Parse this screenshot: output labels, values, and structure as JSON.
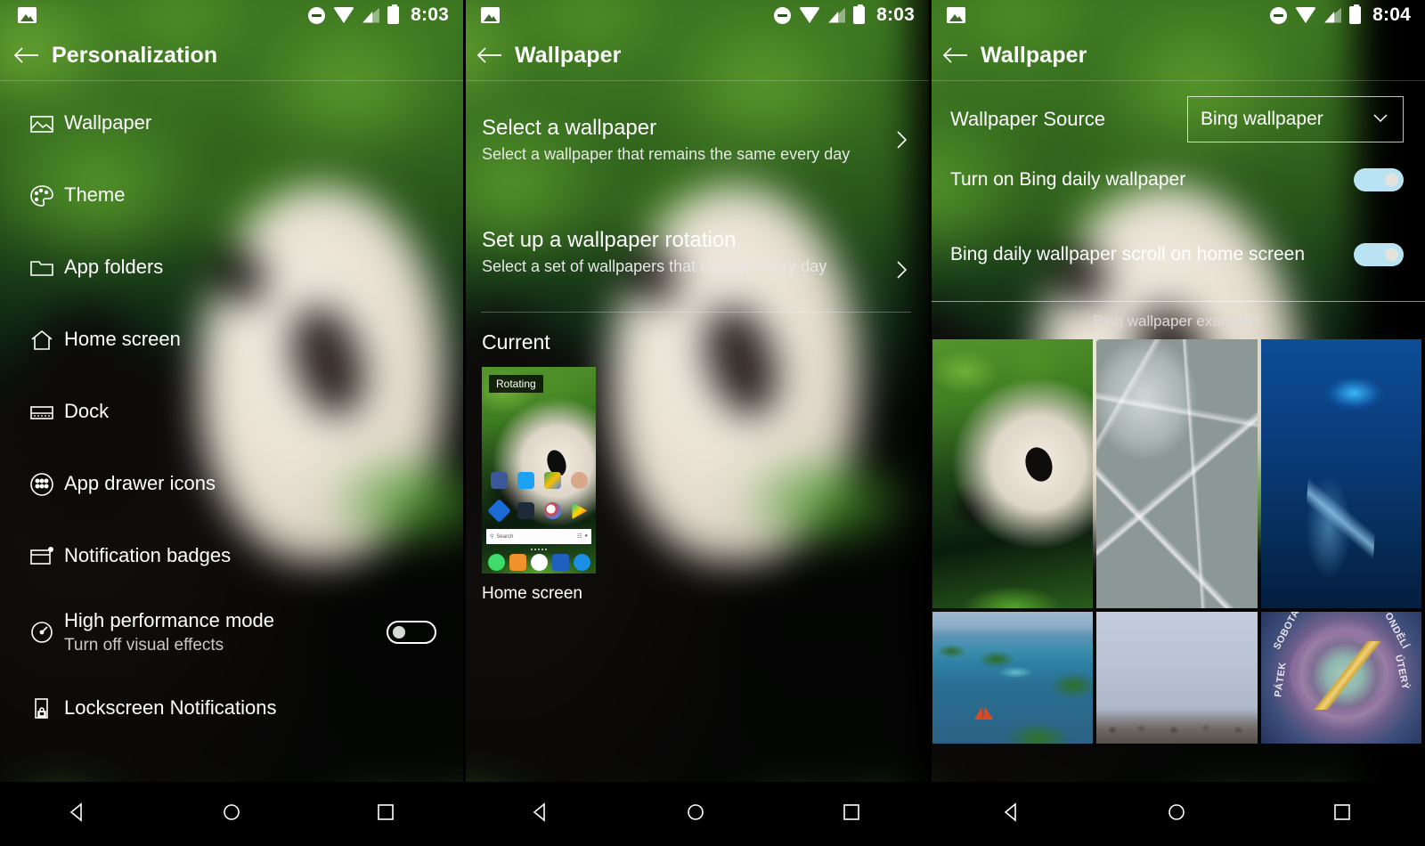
{
  "status_bar": {
    "notification_icon": "photo-icon",
    "icons": [
      "do-not-disturb-icon",
      "wifi-icon",
      "signal-icon",
      "battery-icon"
    ],
    "time_panel1": "8:03",
    "time_panel2": "8:03",
    "time_panel3": "8:04"
  },
  "panel1": {
    "title": "Personalization",
    "back_icon": "back-arrow-icon",
    "items": [
      {
        "label": "Wallpaper",
        "icon": "image-icon"
      },
      {
        "label": "Theme",
        "icon": "palette-icon"
      },
      {
        "label": "App folders",
        "icon": "folder-icon"
      },
      {
        "label": "Home screen",
        "icon": "home-icon"
      },
      {
        "label": "Dock",
        "icon": "dock-icon"
      },
      {
        "label": "App drawer icons",
        "icon": "app-drawer-icon"
      },
      {
        "label": "Notification badges",
        "icon": "notification-badge-icon"
      },
      {
        "label": "High performance mode",
        "sub": "Turn off visual effects",
        "icon": "speedometer-icon",
        "toggle": "off"
      },
      {
        "label": "Lockscreen Notifications",
        "icon": "lock-phone-icon"
      }
    ]
  },
  "panel2": {
    "title": "Wallpaper",
    "back_icon": "back-arrow-icon",
    "rows": [
      {
        "title": "Select a wallpaper",
        "sub": "Select a wallpaper that remains the same every day",
        "chevron": "chevron-right-icon"
      },
      {
        "title": "Set up a wallpaper rotation",
        "sub": "Select a set of wallpapers that change every day",
        "chevron": "chevron-right-icon"
      }
    ],
    "section_label": "Current",
    "thumbnail": {
      "badge": "Rotating",
      "caption": "Home screen",
      "search_placeholder": "Search",
      "row1_icons": [
        "facebook-icon",
        "twitter-icon",
        "maps-icon",
        "contact-icon"
      ],
      "row2_icons": [
        "outlook-icon",
        "grid-icon",
        "cortana-icon",
        "play-store-icon"
      ],
      "dock_icons": [
        "phone-icon",
        "messages-icon",
        "app-drawer-icon",
        "office-icon",
        "edge-icon"
      ]
    }
  },
  "panel3": {
    "title": "Wallpaper",
    "back_icon": "back-arrow-icon",
    "source_label": "Wallpaper Source",
    "source_value": "Bing wallpaper",
    "source_chevron": "chevron-down-icon",
    "toggles": [
      {
        "label": "Turn on Bing daily wallpaper",
        "state": "on"
      },
      {
        "label": "Bing daily wallpaper scroll on home screen",
        "state": "on"
      }
    ],
    "examples_label": "Bing wallpaper examples",
    "gallery": [
      {
        "name": "panda-in-ferns"
      },
      {
        "name": "ice-rock-pattern"
      },
      {
        "name": "dolphins-bubble-ring"
      },
      {
        "name": "tropical-island-lagoon"
      },
      {
        "name": "birds-on-rocks"
      },
      {
        "name": "astronomical-clock"
      }
    ],
    "clock_labels": [
      "SOBOTA",
      "PONDĚLÍ",
      "ÚTERÝ",
      "PÁTEK"
    ]
  },
  "nav_bar": {
    "back": "nav-back-icon",
    "home": "nav-home-icon",
    "recents": "nav-recents-icon"
  },
  "colors": {
    "toggle_on": "#b9e3f2",
    "accent_green": "#4f8f27"
  }
}
